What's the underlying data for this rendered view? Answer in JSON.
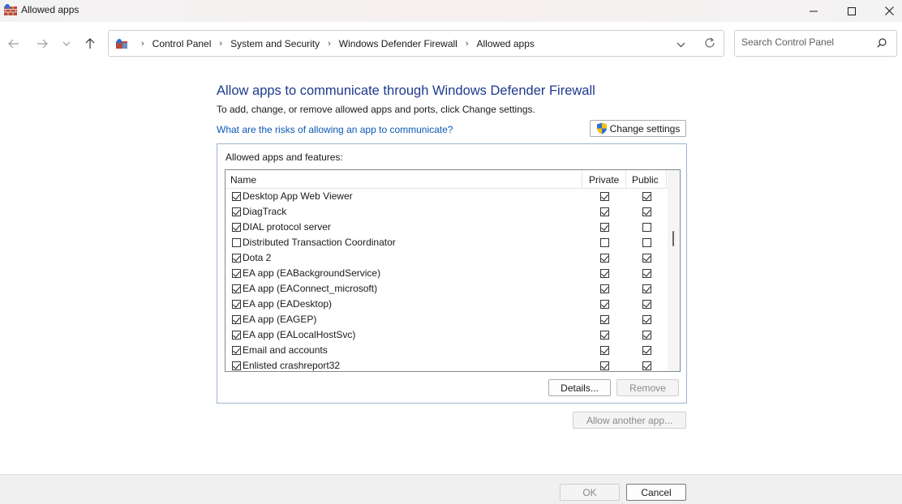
{
  "window": {
    "title": "Allowed apps"
  },
  "breadcrumb": [
    "Control Panel",
    "System and Security",
    "Windows Defender Firewall",
    "Allowed apps"
  ],
  "search": {
    "placeholder": "Search Control Panel"
  },
  "main": {
    "heading": "Allow apps to communicate through Windows Defender Firewall",
    "subtitle": "To add, change, or remove allowed apps and ports, click Change settings.",
    "risk_link": "What are the risks of allowing an app to communicate?",
    "change_settings_label": "Change settings",
    "group_title": "Allowed apps and features:"
  },
  "table": {
    "columns": [
      "Name",
      "Private",
      "Public"
    ],
    "rows": [
      {
        "name": "Desktop App Web Viewer",
        "enabled": true,
        "private": true,
        "public": true
      },
      {
        "name": "DiagTrack",
        "enabled": true,
        "private": true,
        "public": true
      },
      {
        "name": "DIAL protocol server",
        "enabled": true,
        "private": true,
        "public": false
      },
      {
        "name": "Distributed Transaction Coordinator",
        "enabled": false,
        "private": false,
        "public": false
      },
      {
        "name": "Dota 2",
        "enabled": true,
        "private": true,
        "public": true
      },
      {
        "name": "EA app (EABackgroundService)",
        "enabled": true,
        "private": true,
        "public": true
      },
      {
        "name": "EA app (EAConnect_microsoft)",
        "enabled": true,
        "private": true,
        "public": true
      },
      {
        "name": "EA app (EADesktop)",
        "enabled": true,
        "private": true,
        "public": true
      },
      {
        "name": "EA app (EAGEP)",
        "enabled": true,
        "private": true,
        "public": true
      },
      {
        "name": "EA app (EALocalHostSvc)",
        "enabled": true,
        "private": true,
        "public": true
      },
      {
        "name": "Email and accounts",
        "enabled": true,
        "private": true,
        "public": true
      },
      {
        "name": "Enlisted crashreport32",
        "enabled": true,
        "private": true,
        "public": true
      }
    ]
  },
  "buttons": {
    "details": "Details...",
    "remove": "Remove",
    "allow_another": "Allow another app...",
    "ok": "OK",
    "cancel": "Cancel"
  },
  "colors": {
    "heading": "#1e3a8c",
    "link": "#0b57b5",
    "shield_blue": "#2f6fd6",
    "shield_yellow": "#f4c20d"
  }
}
